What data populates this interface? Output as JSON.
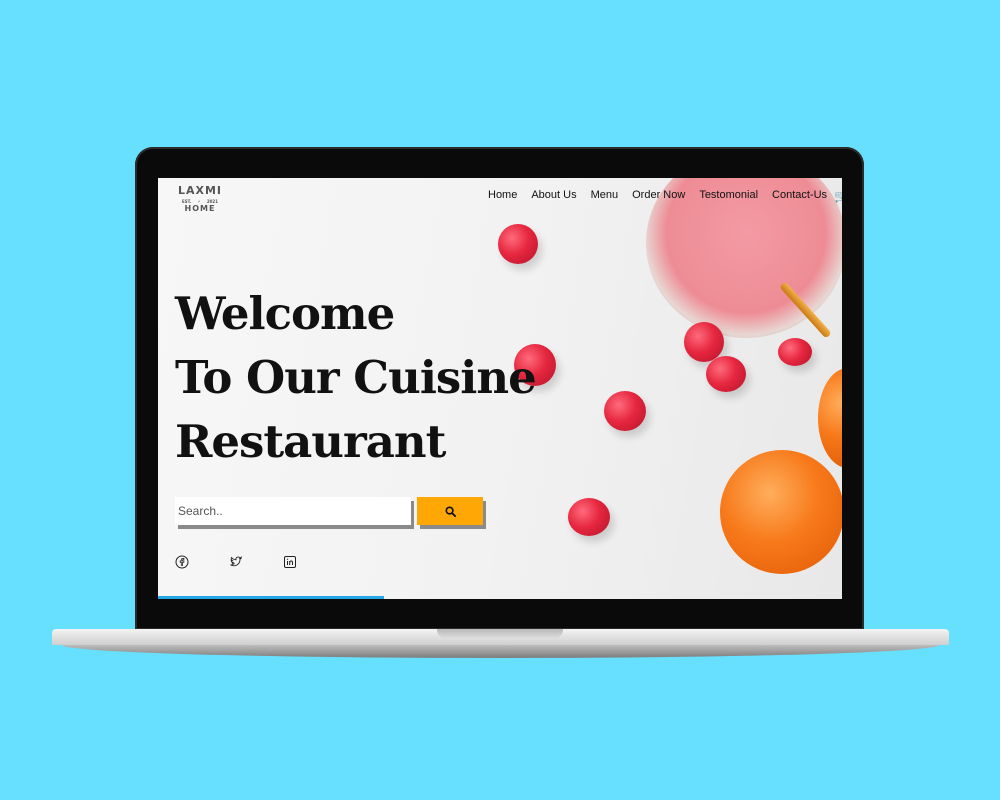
{
  "logo": {
    "line1": "LAXMI",
    "est_left": "EST.",
    "est_right": "2021",
    "line3": "HOME"
  },
  "nav": {
    "items": [
      "Home",
      "About Us",
      "Menu",
      "Order Now",
      "Testomonial",
      "Contact-Us"
    ]
  },
  "hero": {
    "line1": "Welcome",
    "line2": "To Our Cuisine",
    "line3": "Restaurant"
  },
  "search": {
    "placeholder": "Search.."
  },
  "icons": {
    "cart": "cart-icon",
    "search": "search-icon",
    "social": [
      "facebook-icon",
      "twitter-icon",
      "linkedin-icon"
    ]
  },
  "colors": {
    "background": "#66e0fe",
    "accent": "#ffa704",
    "progress": "#27a6e6"
  }
}
